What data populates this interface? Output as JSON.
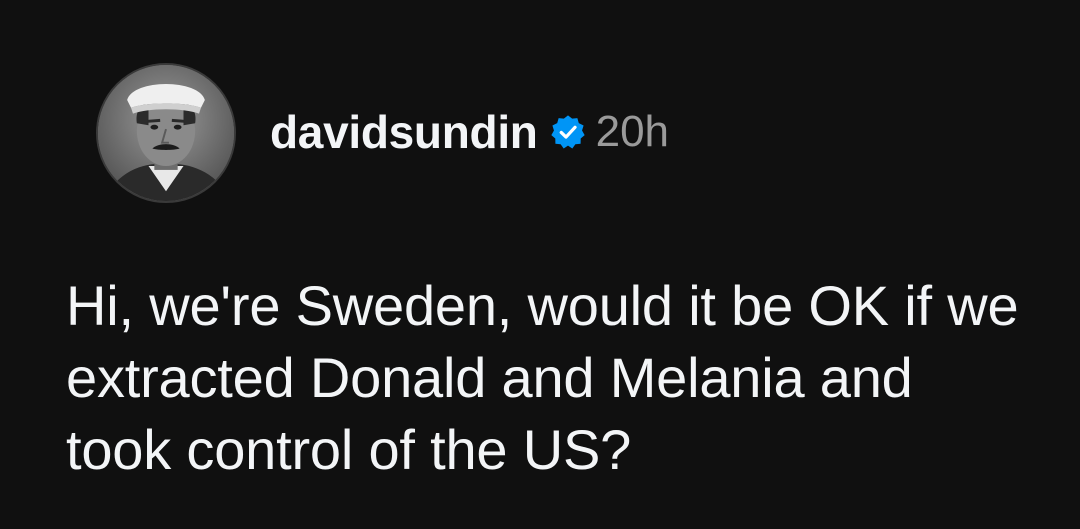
{
  "post": {
    "author": {
      "username": "davidsundin",
      "verified": true,
      "verified_badge_icon": "verified-badge-icon",
      "avatar_icon": "profile-photo-avatar"
    },
    "timestamp": "20h",
    "text": "Hi, we're Sweden, would it be OK if we extracted Donald and Melania and took control of the US?"
  },
  "colors": {
    "background": "#101010",
    "primary_text": "#f3f5f7",
    "secondary_text": "#9a9a9a",
    "verified_blue": "#0095f6"
  }
}
